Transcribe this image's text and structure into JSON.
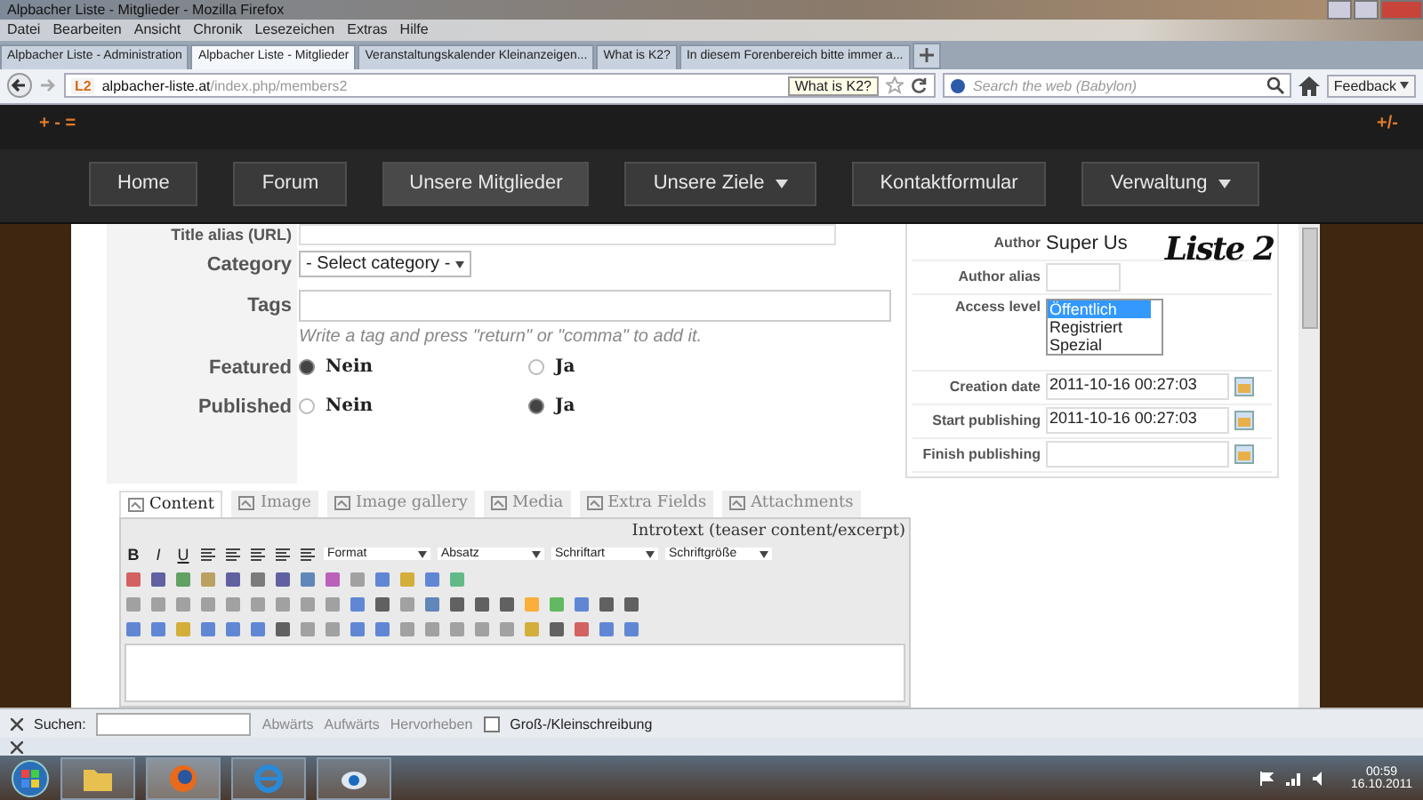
{
  "window": {
    "title": "Alpbacher Liste - Mitglieder - Mozilla Firefox"
  },
  "menu": [
    "Datei",
    "Bearbeiten",
    "Ansicht",
    "Chronik",
    "Lesezeichen",
    "Extras",
    "Hilfe"
  ],
  "browser_tabs": [
    {
      "label": "Alpbacher Liste - Administration",
      "selected": false
    },
    {
      "label": "Alpbacher Liste - Mitglieder",
      "selected": true
    },
    {
      "label": "Veranstaltungskalender Kleinanzeigen...",
      "selected": false
    },
    {
      "label": "What is K2?",
      "selected": false
    },
    {
      "label": "In diesem Forenbereich bitte immer a...",
      "selected": false
    }
  ],
  "address_bar": {
    "domain": "alpbacher-liste.at",
    "path": "/index.php/members2",
    "favicon": "L2",
    "tooltip": "What is K2?"
  },
  "search": {
    "placeholder": "Search the web (Babylon)"
  },
  "feedback_button": "Feedback",
  "site_header": {
    "left_marks": "+ - =",
    "right_marks": "+/-"
  },
  "site_nav": [
    {
      "label": "Home",
      "dropdown": false,
      "selected": false
    },
    {
      "label": "Forum",
      "dropdown": false,
      "selected": false
    },
    {
      "label": "Unsere Mitglieder",
      "dropdown": false,
      "selected": true
    },
    {
      "label": "Unsere Ziele",
      "dropdown": true,
      "selected": false
    },
    {
      "label": "Kontaktformular",
      "dropdown": false,
      "selected": false
    },
    {
      "label": "Verwaltung",
      "dropdown": true,
      "selected": false
    }
  ],
  "form": {
    "alias_label": "Title alias (URL)",
    "category_label": "Category",
    "category_value": "- Select category -",
    "tags_label": "Tags",
    "tags_hint": "Write a tag and press \"return\" or \"comma\" to add it.",
    "radios": [
      {
        "label": "Featured",
        "options": [
          {
            "label": "Nein",
            "selected": true
          },
          {
            "label": "Ja",
            "selected": false
          }
        ]
      },
      {
        "label": "Published",
        "options": [
          {
            "label": "Nein",
            "selected": false
          },
          {
            "label": "Ja",
            "selected": true
          }
        ]
      }
    ]
  },
  "side_panel": {
    "author_label": "Author",
    "author_value": "Super Us",
    "alias_label": "Author alias",
    "access_label": "Access level",
    "access_options": [
      {
        "label": "Öffentlich",
        "selected": true
      },
      {
        "label": "Registriert",
        "selected": false
      },
      {
        "label": "Spezial",
        "selected": false
      }
    ],
    "dates": [
      {
        "label": "Creation date",
        "value": "2011-10-16 00:27:03"
      },
      {
        "label": "Start publishing",
        "value": "2011-10-16 00:27:03"
      },
      {
        "label": "Finish publishing"
      }
    ]
  },
  "logo": "Liste 2",
  "content_tabs": [
    {
      "label": "Content",
      "selected": true
    },
    {
      "label": "Image",
      "selected": false
    },
    {
      "label": "Image gallery",
      "selected": false
    },
    {
      "label": "Media",
      "selected": false
    },
    {
      "label": "Extra Fields",
      "selected": false
    },
    {
      "label": "Attachments",
      "selected": false
    }
  ],
  "editor": {
    "format_buttons": [
      "B",
      "I",
      "U"
    ],
    "title": "Introtext (teaser content/excerpt)",
    "dropdowns": [
      "Format",
      "Absatz",
      "Schriftart",
      "Schriftgröße"
    ]
  },
  "find_bar": {
    "label": "Suchen:",
    "buttons": [
      "Abwärts",
      "Aufwärts",
      "Hervorheben"
    ],
    "match_case": {
      "label": "Groß-/Kleinschreibung",
      "checked": false
    }
  },
  "taskbar": {
    "time": "00:59",
    "date": "16.10.2011"
  }
}
